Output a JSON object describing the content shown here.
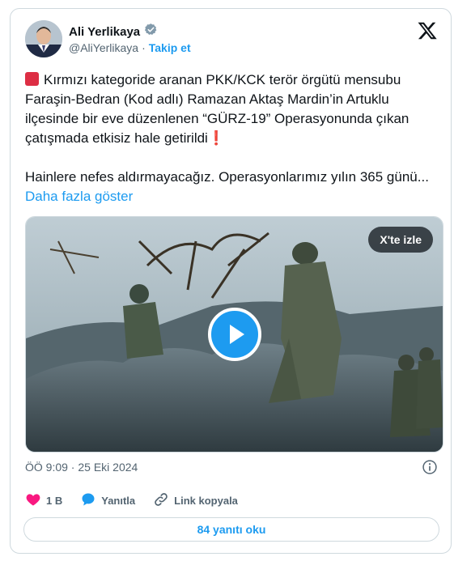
{
  "author": {
    "name": "Ali Yerlikaya",
    "handle": "@AliYerlikaya",
    "separator": "·",
    "follow_label": "Takip et"
  },
  "post": {
    "paragraph1": "Kırmızı kategoride aranan PKK/KCK terör örgütü mensubu Faraşin-Bedran (Kod adlı) Ramazan Aktaş Mardin’in Artuklu ilçesinde bir eve düzenlenen “GÜRZ-19” Operasyonunda çıkan çatışmada etkisiz hale getirildi",
    "paragraph2": "Hainlere nefes aldırmayacağız. Operasyonlarımız yılın 365 günü...",
    "show_more": "Daha fazla göster"
  },
  "media": {
    "watch_label": "X'te izle"
  },
  "timestamp": "ÖÖ 9:09 · 25 Eki 2024",
  "actions": {
    "likes": "1 B",
    "reply": "Yanıtla",
    "copy_link": "Link kopyala"
  },
  "read_replies": "84 yanıtı oku",
  "colors": {
    "accent": "#1d9bf0",
    "like": "#f91880",
    "alert_red": "#dd2e44",
    "verified": "#829aab"
  }
}
